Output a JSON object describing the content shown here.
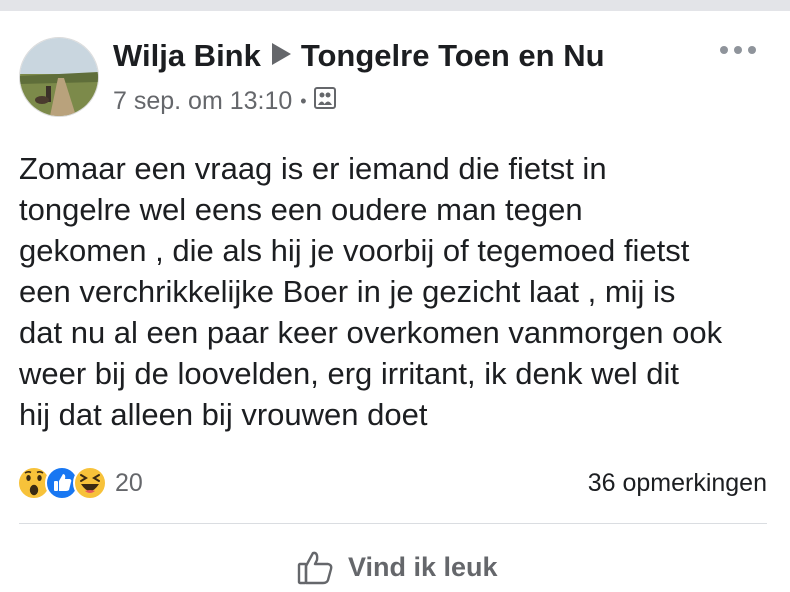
{
  "post": {
    "author": "Wilja Bink",
    "group": "Tongelre Toen en Nu",
    "timestamp": "7 sep. om 13:10",
    "separator": "•",
    "audience_icon": "photo-audience-icon",
    "more_icon": "more-options-icon",
    "text_lines": [
      "Zomaar een vraag is er iemand die fietst in",
      "tongelre wel eens een oudere man tegen",
      "gekomen  , die als hij je voorbij of tegemoed fietst",
      "een verchrikkelijke Boer in je gezicht laat , mij is",
      "dat nu al een paar keer overkomen vanmorgen ook",
      "weer bij de loovelden, erg irritant,  ik denk wel dit",
      "hij dat alleen bij vrouwen doet"
    ]
  },
  "reactions": {
    "icons": [
      "wow-reaction-icon",
      "like-reaction-icon",
      "haha-reaction-icon"
    ],
    "count": "20",
    "comments": "36 opmerkingen"
  },
  "actions": {
    "like_label": "Vind ik leuk"
  },
  "colors": {
    "text": "#1c1e21",
    "secondary": "#65676b",
    "like_blue": "#1877f2",
    "emoji_yellow": "#f7c23a"
  }
}
